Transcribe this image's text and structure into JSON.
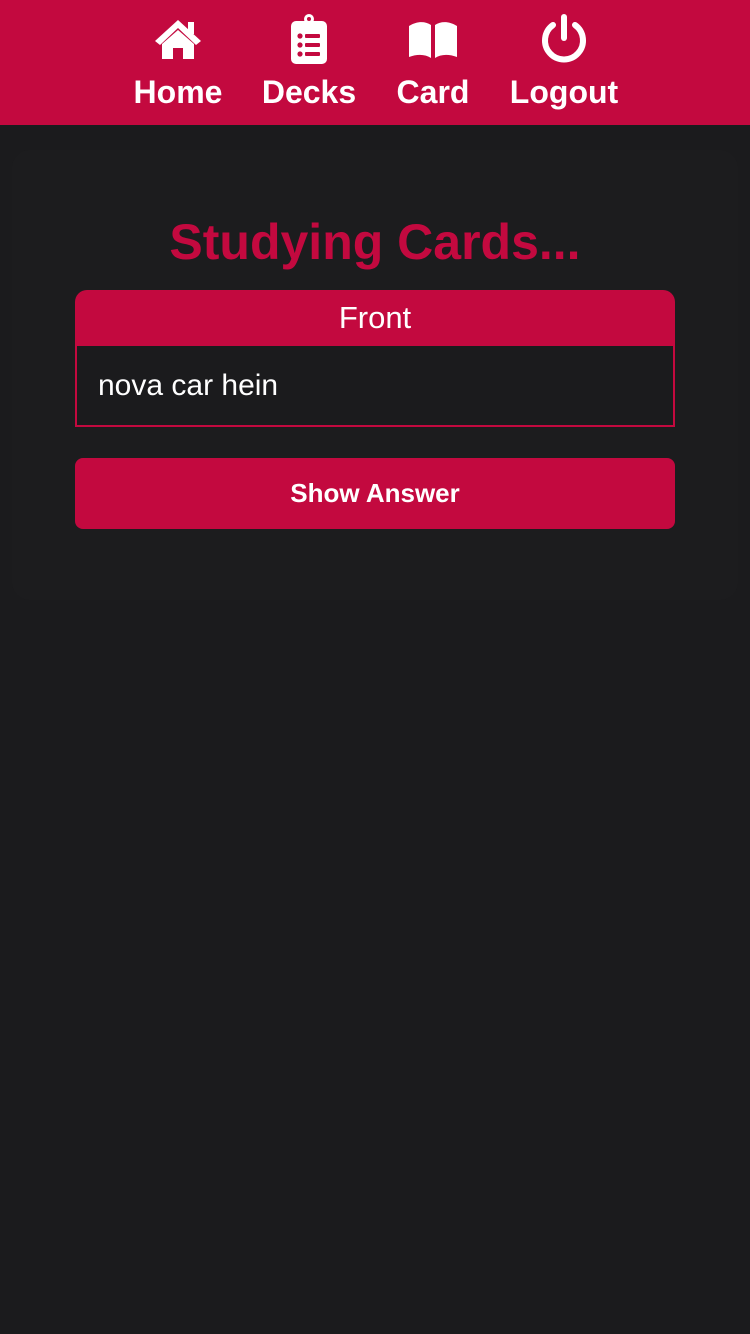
{
  "nav": {
    "items": [
      {
        "label": "Home",
        "icon": "home-icon"
      },
      {
        "label": "Decks",
        "icon": "clipboard-list-icon"
      },
      {
        "label": "Card",
        "icon": "book-open-icon"
      },
      {
        "label": "Logout",
        "icon": "power-icon"
      }
    ]
  },
  "study": {
    "title": "Studying Cards...",
    "card_side_label": "Front",
    "card_text": "nova car hein",
    "show_answer_label": "Show Answer"
  },
  "colors": {
    "accent": "#c3093f",
    "background": "#1b1b1d",
    "text": "#ffffff"
  }
}
